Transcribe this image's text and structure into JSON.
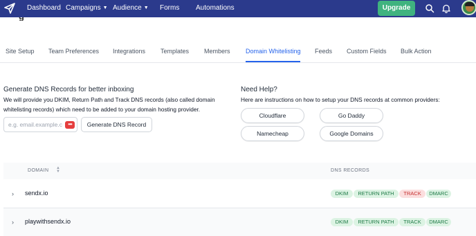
{
  "nav": {
    "items": [
      {
        "label": "Dashboard"
      },
      {
        "label": "Campaigns"
      },
      {
        "label": "Audience"
      },
      {
        "label": "Forms"
      },
      {
        "label": "Automations"
      }
    ],
    "upgrade_label": "Upgrade",
    "icons": [
      "paper-plane-logo",
      "search-icon",
      "bell-icon",
      "avatar"
    ],
    "colors": {
      "nav_bg": "#2b3a8c",
      "upgrade_bg": "#3fb37f",
      "accent": "#2563eb"
    }
  },
  "page": {
    "title_fragment": "g"
  },
  "tabs": [
    {
      "label": "Site Setup"
    },
    {
      "label": "Team Preferences"
    },
    {
      "label": "Integrations"
    },
    {
      "label": "Templates"
    },
    {
      "label": "Members"
    },
    {
      "label": "Domain Whitelisting",
      "active": true
    },
    {
      "label": "Feeds"
    },
    {
      "label": "Custom Fields"
    },
    {
      "label": "Bulk Action"
    }
  ],
  "generate": {
    "title": "Generate DNS Records for better inboxing",
    "desc_line1": "We will provide you DKIM, Return Path and Track DNS records (also called domain",
    "desc_line2": "whitelisting records) which need to be added to your domain hosting provider.",
    "email_placeholder": "e.g. email.example.com",
    "password_icon_text": "•••",
    "button_label": "Generate DNS Record"
  },
  "help": {
    "title": "Need Help?",
    "desc": "Here are instructions on how to setup your DNS records at common providers:",
    "providers": [
      "Cloudflare",
      "Go Daddy",
      "Namecheap",
      "Google Domains"
    ]
  },
  "table": {
    "headers": {
      "domain": "DOMAIN",
      "dns": "DNS RECORDS"
    },
    "rows": [
      {
        "domain": "sendx.io",
        "records": [
          {
            "label": "DKIM",
            "status": "ok"
          },
          {
            "label": "RETURN PATH",
            "status": "ok"
          },
          {
            "label": "TRACK",
            "status": "error"
          },
          {
            "label": "DMARC",
            "status": "ok"
          }
        ]
      },
      {
        "domain": "playwithsendx.io",
        "records": [
          {
            "label": "DKIM",
            "status": "ok"
          },
          {
            "label": "RETURN PATH",
            "status": "ok"
          },
          {
            "label": "TRACK",
            "status": "ok"
          },
          {
            "label": "DMARC",
            "status": "ok"
          }
        ]
      }
    ]
  }
}
